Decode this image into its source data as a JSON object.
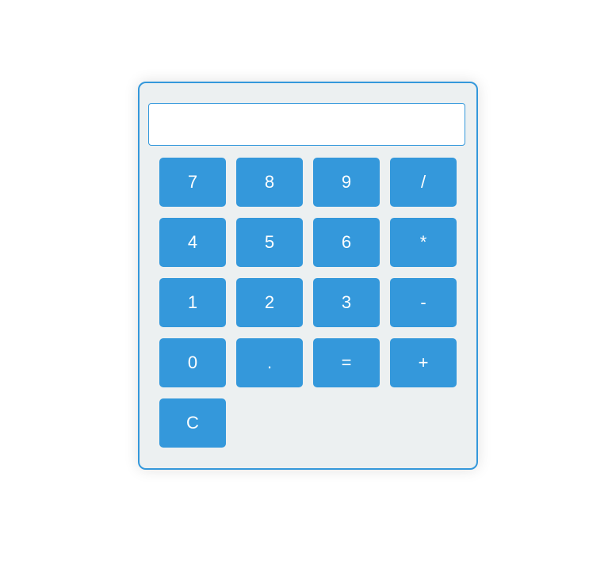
{
  "display": {
    "value": "",
    "placeholder": ""
  },
  "keys": [
    {
      "label": "7",
      "name": "key-7-button"
    },
    {
      "label": "8",
      "name": "key-8-button"
    },
    {
      "label": "9",
      "name": "key-9-button"
    },
    {
      "label": "/",
      "name": "divide-button"
    },
    {
      "label": "4",
      "name": "key-4-button"
    },
    {
      "label": "5",
      "name": "key-5-button"
    },
    {
      "label": "6",
      "name": "key-6-button"
    },
    {
      "label": "*",
      "name": "multiply-button"
    },
    {
      "label": "1",
      "name": "key-1-button"
    },
    {
      "label": "2",
      "name": "key-2-button"
    },
    {
      "label": "3",
      "name": "key-3-button"
    },
    {
      "label": "-",
      "name": "subtract-button"
    },
    {
      "label": "0",
      "name": "key-0-button"
    },
    {
      "label": ".",
      "name": "decimal-button"
    },
    {
      "label": "=",
      "name": "equals-button"
    },
    {
      "label": "+",
      "name": "add-button"
    },
    {
      "label": "C",
      "name": "clear-button"
    }
  ],
  "colors": {
    "accent": "#3498db",
    "panel": "#ecf0f1",
    "key_text": "#ffffff"
  }
}
